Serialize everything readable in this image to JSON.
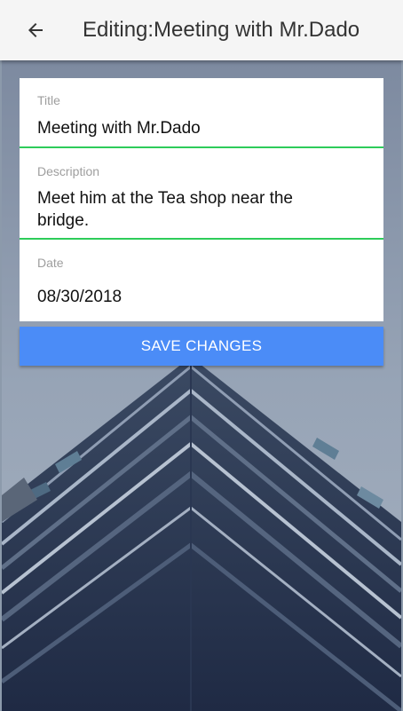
{
  "app_bar": {
    "back_icon": "arrow-left-icon",
    "title": "Editing:Meeting with Mr.Dado"
  },
  "form": {
    "title_label": "Title",
    "title_value": "Meeting with Mr.Dado",
    "description_label": "Description",
    "description_value_line1": "Meet him at the Tea shop near the",
    "description_value_line2": "bridge.",
    "date_label": "Date",
    "date_value": "08/30/2018"
  },
  "actions": {
    "save_label": "SAVE CHANGES"
  },
  "colors": {
    "accent_underline": "#2ecc5a",
    "button": "#4b8cf7",
    "app_bar": "#f5f5f5"
  }
}
